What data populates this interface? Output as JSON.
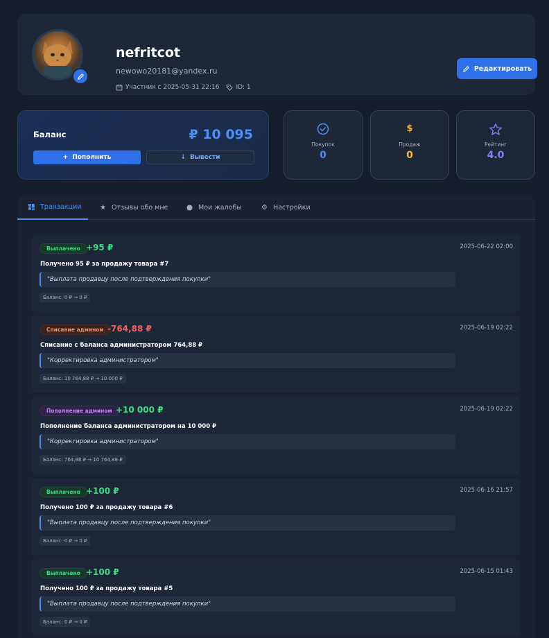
{
  "profile": {
    "username": "nefritcot",
    "email": "newowo20181@yandex.ru",
    "member_since": "Участник с 2025-05-31 22:16",
    "id_label": "ID: 1",
    "edit_label": "Редактировать"
  },
  "balance": {
    "label": "Баланс",
    "amount": "₽ 10 095",
    "topup_label": "Пополнить",
    "withdraw_label": "Вывести"
  },
  "stats": [
    {
      "label": "Покупок",
      "value": "0",
      "color": "#4d8ff5",
      "icon": "check-circle-icon"
    },
    {
      "label": "Продаж",
      "value": "0",
      "color": "#f5b82e",
      "icon": "dollar-icon"
    },
    {
      "label": "Рейтинг",
      "value": "4.0",
      "color": "#7b84f0",
      "icon": "star-icon"
    }
  ],
  "tabs": [
    {
      "label": "Транзакции",
      "icon": "grid-icon",
      "active": true
    },
    {
      "label": "Отзывы обо мне",
      "icon": "star-icon",
      "active": false
    },
    {
      "label": "Мои жалобы",
      "icon": "circle-icon",
      "active": false
    },
    {
      "label": "Настройки",
      "icon": "gear-icon",
      "active": false
    }
  ],
  "transactions": [
    {
      "badge": "Выплачено",
      "badge_type": "paid",
      "amount": "+95 ₽",
      "amount_type": "positive",
      "date": "2025-06-22 02:00",
      "title": "Получено 95 ₽ за продажу товара #7",
      "comment": "\"Выплата продавцу после подтверждения покупки\"",
      "balance_change": "Баланс: 0 ₽ → 0 ₽"
    },
    {
      "badge": "Списание админом",
      "badge_type": "debit",
      "amount": "-764,88 ₽",
      "amount_type": "negative",
      "date": "2025-06-19 02:22",
      "title": "Списание с баланса администратором 764,88 ₽",
      "comment": "\"Корректировка администратором\"",
      "balance_change": "Баланс: 10 764,88 ₽ → 10 000 ₽"
    },
    {
      "badge": "Пополнение админом",
      "badge_type": "credit",
      "amount": "+10 000 ₽",
      "amount_type": "positive",
      "date": "2025-06-19 02:22",
      "title": "Пополнение баланса администратором на 10 000 ₽",
      "comment": "\"Корректировка администратором\"",
      "balance_change": "Баланс: 764,88 ₽ → 10 764,88 ₽"
    },
    {
      "badge": "Выплачено",
      "badge_type": "paid",
      "amount": "+100 ₽",
      "amount_type": "positive",
      "date": "2025-06-16 21:57",
      "title": "Получено 100 ₽ за продажу товара #6",
      "comment": "\"Выплата продавцу после подтверждения покупки\"",
      "balance_change": "Баланс: 0 ₽ → 0 ₽"
    },
    {
      "badge": "Выплачено",
      "badge_type": "paid",
      "amount": "+100 ₽",
      "amount_type": "positive",
      "date": "2025-06-15 01:43",
      "title": "Получено 100 ₽ за продажу товара #5",
      "comment": "\"Выплата продавцу после подтверждения покупки\"",
      "balance_change": "Баланс: 0 ₽ → 0 ₽"
    }
  ],
  "colors": {
    "accent": "#2f6fe8",
    "positive": "#3ddc84",
    "negative": "#f0605a"
  }
}
